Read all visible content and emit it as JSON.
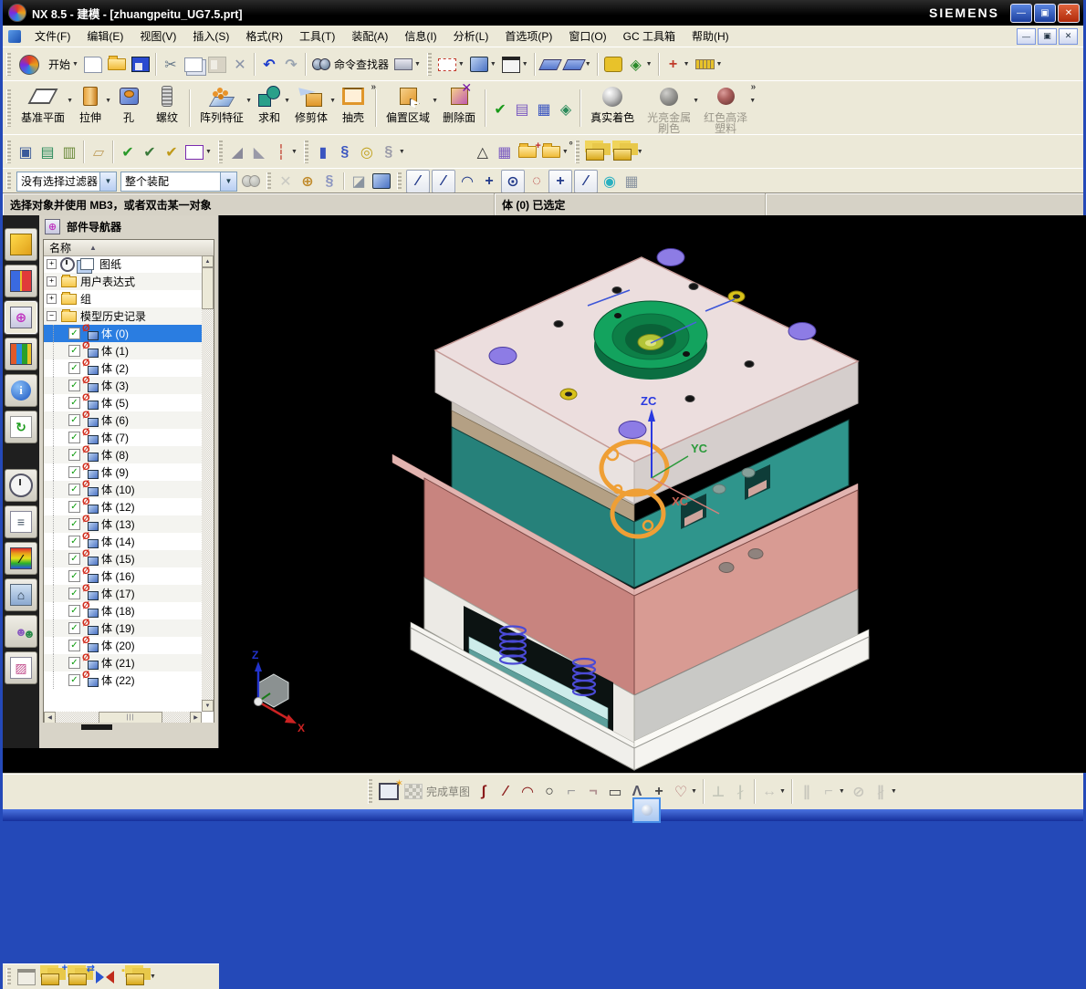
{
  "window": {
    "title": "NX 8.5 - 建模 - [zhuangpeitu_UG7.5.prt]",
    "brand": "SIEMENS"
  },
  "menubar": {
    "items": [
      "文件(F)",
      "编辑(E)",
      "视图(V)",
      "插入(S)",
      "格式(R)",
      "工具(T)",
      "装配(A)",
      "信息(I)",
      "分析(L)",
      "首选项(P)",
      "窗口(O)",
      "GC 工具箱",
      "帮助(H)"
    ]
  },
  "toolbar_standard": {
    "start_label": "开始",
    "items": [
      {
        "name": "new-document-button",
        "cls": "i-new"
      },
      {
        "name": "open-button",
        "cls": "i-openf"
      },
      {
        "name": "save-button",
        "cls": "i-save"
      },
      {
        "type": "sep"
      },
      {
        "name": "cut-button",
        "g": "✂",
        "c": "#667788"
      },
      {
        "name": "copy-button",
        "cls": "i-copy"
      },
      {
        "name": "paste-button",
        "cls": "i-paste",
        "dim": 1
      },
      {
        "name": "delete-button",
        "g": "✕",
        "c": "#8a94a8"
      },
      {
        "type": "sep"
      },
      {
        "name": "undo-button",
        "g": "↶",
        "c": "#1a3acc"
      },
      {
        "name": "redo-button",
        "g": "↷",
        "c": "#9aa4b0"
      },
      {
        "type": "sep"
      },
      {
        "name": "command-finder-button",
        "cls": "i-binoc",
        "label": "命令查找器"
      },
      {
        "name": "touch-mode-button",
        "cls": "i-laptop",
        "dd": 1
      },
      {
        "type": "grip"
      },
      {
        "name": "fit-view-button",
        "cls": "i-fit",
        "dd": 1
      },
      {
        "name": "shaded-view-button",
        "cls": "i-cube3d",
        "dd": 1
      },
      {
        "name": "view-background-button",
        "cls": "i-rect",
        "dd": 1
      },
      {
        "type": "sep"
      },
      {
        "name": "show-datum-button",
        "cls": "i-datum"
      },
      {
        "name": "show-datum-2-button",
        "cls": "i-datum",
        "dd": 1
      },
      {
        "type": "sep"
      },
      {
        "name": "snapshot-button",
        "cls": "i-key"
      },
      {
        "name": "view-orient-button",
        "g": "◈",
        "c": "#2a8a2a",
        "dd": 1
      },
      {
        "type": "sep"
      },
      {
        "name": "measure-button",
        "g": "+",
        "c": "#c03a2a",
        "dd": 1
      },
      {
        "name": "ruler-button",
        "cls": "i-ruler",
        "dd": 1
      }
    ]
  },
  "toolbar_features": {
    "buttons": [
      {
        "group": 1,
        "label": "基准平面",
        "icon": "datum-plane",
        "dd": 1
      },
      {
        "group": 1,
        "label": "拉伸",
        "icon": "extrude",
        "dd": 1
      },
      {
        "group": 1,
        "label": "孔",
        "icon": "hole"
      },
      {
        "group": 1,
        "label": "螺纹",
        "icon": "thread"
      },
      {
        "group": 2,
        "label": "阵列特征",
        "icon": "pattern",
        "dd": 1
      },
      {
        "group": 2,
        "label": "求和",
        "icon": "unite",
        "dd": 1
      },
      {
        "group": 2,
        "label": "修剪体",
        "icon": "trim-body",
        "dd": 1
      },
      {
        "group": 2,
        "label": "抽壳",
        "icon": "shell"
      },
      {
        "group": 3,
        "label": "偏置区域",
        "icon": "offset-region",
        "dd": 1
      },
      {
        "group": 3,
        "label": "删除面",
        "icon": "delete-face"
      },
      {
        "group": 5,
        "label": "真实着色",
        "icon": "true-shading"
      },
      {
        "group": 5,
        "label": "光亮金属\n刷色",
        "icon": "metal-shading",
        "dd": 1,
        "disabled": 1
      },
      {
        "group": 5,
        "label": "红色高泽\n塑料",
        "icon": "red-plastic",
        "dd": 1,
        "disabled": 1
      }
    ],
    "check_group": [
      {
        "name": "examine-geometry-check-button",
        "g": "✔",
        "c": "#1a9a1a"
      },
      {
        "name": "spreadsheet-button",
        "g": "▤",
        "c": "#7a5ac0"
      },
      {
        "name": "grid-check-button",
        "g": "▦",
        "c": "#3a55c0"
      },
      {
        "name": "sheet-metal-button",
        "g": "◈",
        "c": "#2a8a5a"
      }
    ]
  },
  "toolbar_small": {
    "items": [
      {
        "name": "fit-frame-button",
        "g": "▣",
        "c": "#3a5a9a"
      },
      {
        "name": "layer-settings-button",
        "g": "▤",
        "c": "#2a8a5a"
      },
      {
        "name": "layer-category-button",
        "g": "▥",
        "c": "#6a8a3a"
      },
      {
        "type": "sep"
      },
      {
        "name": "annotation-note-button",
        "g": "▱",
        "c": "#c0a060"
      },
      {
        "type": "sep"
      },
      {
        "name": "check-parts-button",
        "g": "✔",
        "c": "#2a9a2a"
      },
      {
        "name": "check-sketch-button",
        "g": "✔",
        "c": "#3a7a3a"
      },
      {
        "name": "check-box-button",
        "g": "✔",
        "c": "#c09a1a"
      },
      {
        "name": "abc-annotation-button",
        "cls": "i-abc",
        "dd": 1
      },
      {
        "type": "grip"
      },
      {
        "name": "draft-analysis-button",
        "g": "◢",
        "c": "#8a8a9a"
      },
      {
        "name": "section-analysis-button",
        "g": "◣",
        "c": "#9a9aa8"
      },
      {
        "name": "deviation-gauge-button",
        "g": "┆",
        "c": "#c03a2a",
        "dd": 1
      },
      {
        "type": "grip"
      },
      {
        "name": "tube-button",
        "g": "▮",
        "c": "#3a55c0"
      },
      {
        "name": "spring-tool-button",
        "g": "§",
        "c": "#3a55c0"
      },
      {
        "name": "coil-button",
        "g": "◎",
        "c": "#c0a01a"
      },
      {
        "name": "spring-disabled-button",
        "g": "§",
        "c": "#9a9aa8",
        "dd": 1
      },
      {
        "type": "gap"
      },
      {
        "name": "triangle-mesh-button",
        "g": "△",
        "c": "#333333"
      },
      {
        "name": "table-grid-button",
        "g": "▦",
        "c": "#7a5ac0"
      },
      {
        "name": "folder-new-button",
        "cls": "i-openf",
        "ov": "+",
        "ovc": "#c02a2a"
      },
      {
        "name": "folder-options-button",
        "cls": "i-openf",
        "ov": "°",
        "ovc": "#333333",
        "dd": 1
      },
      {
        "type": "grip"
      },
      {
        "name": "part-family-button",
        "cls": "i-ycubes"
      },
      {
        "name": "part-family-2-button",
        "cls": "i-ycubes",
        "dd": 1
      }
    ]
  },
  "selection_bar": {
    "filter_value": "没有选择过滤器",
    "scope_value": "整个装配",
    "items": [
      {
        "name": "selection-binoculars-button",
        "cls": "i-binoc",
        "dim": 1
      },
      {
        "type": "grip"
      },
      {
        "name": "general-selection-button",
        "g": "✕",
        "c": "#99a4b0",
        "dim": 1
      },
      {
        "name": "snap-handle-button",
        "g": "⊕",
        "c": "#c08a2a"
      },
      {
        "name": "grip-hand-button",
        "g": "§",
        "c": "#8a94c0"
      },
      {
        "type": "sep"
      },
      {
        "name": "face-rule-button",
        "g": "◪",
        "c": "#8a94a0"
      },
      {
        "name": "body-rule-button",
        "cls": "i-cube3d"
      },
      {
        "type": "grip"
      },
      {
        "name": "snap-endpoint-button",
        "g": "∕",
        "c": "#223a8a",
        "box": 1
      },
      {
        "name": "snap-midpoint-button",
        "g": "∕",
        "c": "#223a8a",
        "box": 1
      },
      {
        "name": "snap-curve-button",
        "g": "◠",
        "c": "#223a8a"
      },
      {
        "name": "snap-intersection-button",
        "g": "+",
        "c": "#223a8a"
      },
      {
        "name": "snap-center-button",
        "g": "⊙",
        "c": "#223a8a",
        "box": 1
      },
      {
        "name": "snap-quadrant-button",
        "g": "◌",
        "c": "#b02a2a"
      },
      {
        "name": "snap-point-button",
        "g": "+",
        "c": "#223a8a",
        "box": 1
      },
      {
        "name": "snap-existing-button",
        "g": "∕",
        "c": "#223a8a",
        "box": 1
      },
      {
        "name": "magnet-button",
        "g": "◉",
        "c": "#2ab0c0"
      },
      {
        "name": "grid-snap-button",
        "g": "▦",
        "c": "#8a94a0"
      }
    ]
  },
  "status_bar": {
    "prompt": "选择对象并使用 MB3，或者双击某一对象",
    "status": "体 (0) 已选定"
  },
  "resource_bar": {
    "icons": [
      {
        "name": "assembly-navigator-icon",
        "cls": "r1"
      },
      {
        "name": "constraint-navigator-icon",
        "cls": "r2"
      },
      {
        "name": "part-navigator-icon",
        "cls": "r3",
        "g": "⊕",
        "active": 1
      },
      {
        "name": "reuse-library-icon",
        "cls": "r4"
      },
      {
        "name": "web-browser-icon",
        "cls": "r5",
        "g": "i"
      },
      {
        "name": "history-icon",
        "cls": "r6",
        "g": "↻"
      },
      {
        "type": "gap"
      },
      {
        "name": "clock-icon",
        "cls": "r7"
      },
      {
        "name": "palette-list-icon",
        "cls": "r8",
        "g": "≡"
      },
      {
        "name": "visualization-icon",
        "cls": "r9",
        "g": "∕"
      },
      {
        "name": "scene-icon",
        "cls": "r10",
        "g": "⌂"
      },
      {
        "name": "roles-icon",
        "cls": "r11",
        "g": "☻"
      },
      {
        "name": "gallery-icon",
        "cls": "r12",
        "g": "▨"
      }
    ]
  },
  "navigator": {
    "title": "部件导航器",
    "column_header": "名称",
    "folders": [
      {
        "label": "图纸"
      },
      {
        "label": "用户表达式"
      },
      {
        "label": "组"
      },
      {
        "label": "模型历史记录"
      }
    ],
    "bodies": [
      "体 (0)",
      "体 (1)",
      "体 (2)",
      "体 (3)",
      "体 (5)",
      "体 (6)",
      "体 (7)",
      "体 (8)",
      "体 (9)",
      "体 (10)",
      "体 (12)",
      "体 (13)",
      "体 (14)",
      "体 (15)",
      "体 (16)",
      "体 (17)",
      "体 (18)",
      "体 (19)",
      "体 (20)",
      "体 (21)",
      "体 (22)"
    ],
    "selected": "体 (0)"
  },
  "assembly_toolbar": {
    "items": [
      {
        "name": "show-component-button",
        "cls": "i-rect",
        "dim": 1
      },
      {
        "name": "add-component-button",
        "cls": "i-ycubes",
        "ov": "+",
        "ovc": "#1a55e0"
      },
      {
        "name": "move-component-button",
        "cls": "i-ycubes",
        "ov": "⇄",
        "ovc": "#1a55e0"
      },
      {
        "name": "assembly-constraints-button",
        "cls": "i-bowtie",
        "ov": "▪",
        "ovc": "#e8c22a"
      },
      {
        "name": "pattern-component-button",
        "cls": "i-ycubes",
        "dd": 1
      }
    ]
  },
  "sketch_toolbar": {
    "items": [
      {
        "name": "sketch-profile-button",
        "cls": "i-profile",
        "ov": "✶",
        "ovc": "#e8a01a"
      },
      {
        "name": "finish-sketch-button",
        "cls": "i-checker",
        "label": "完成草图",
        "dim": 1
      },
      {
        "name": "studio-spline-button",
        "g": "∫",
        "c": "#8a1a1a"
      },
      {
        "name": "line-button",
        "g": "∕",
        "c": "#8a1a1a"
      },
      {
        "name": "arc-button",
        "g": "◠",
        "c": "#8a1a1a"
      },
      {
        "name": "circle-button",
        "g": "○",
        "c": "#333333"
      },
      {
        "name": "fillet-button",
        "g": "⌐",
        "c": "#9a9a9a"
      },
      {
        "name": "chamfer-button",
        "g": "¬",
        "c": "#b09090"
      },
      {
        "name": "rectangle-button",
        "g": "▭",
        "c": "#444444"
      },
      {
        "name": "polygon-button",
        "g": "Λ",
        "c": "#555566"
      },
      {
        "name": "point-button",
        "g": "+",
        "c": "#444444"
      },
      {
        "name": "offset-curve-button",
        "g": "♡",
        "c": "#b07070",
        "dd": 1
      },
      {
        "type": "sep"
      },
      {
        "name": "constraint-button",
        "g": "⊥",
        "c": "#88a088",
        "dim": 1
      },
      {
        "name": "auto-constrain-button",
        "g": "∤",
        "c": "#88a088",
        "dim": 1
      },
      {
        "type": "sep"
      },
      {
        "name": "dimension-button",
        "g": "↔",
        "c": "#9a9a9a",
        "dd": 1,
        "dim": 1
      },
      {
        "type": "sep"
      },
      {
        "name": "parallel-button",
        "g": "∥",
        "c": "#9a9a9a",
        "dim": 1
      },
      {
        "name": "perpendicular-button",
        "g": "⌐",
        "c": "#9a9a9a",
        "dd": 1,
        "dim": 1
      },
      {
        "name": "tangent-button",
        "g": "⊘",
        "c": "#9a9a9a",
        "dim": 1
      },
      {
        "name": "equal-button",
        "g": "∦",
        "c": "#9a9a9a",
        "dd": 1,
        "dim": 1
      }
    ]
  },
  "viewport": {
    "wcs": {
      "z": "ZC",
      "y": "YC",
      "x": "XC"
    },
    "triad": {
      "z": "Z",
      "x": "X"
    },
    "colors": {
      "viewport_bg": "#000000",
      "top_plate": "#ecdede",
      "a_plate_teal": "#26817a",
      "a_plate_teal_right": "#2f958c",
      "b_plate_salmon": "#c8847f",
      "b_plate_salmon_right": "#d89b93",
      "base_gray": "#f0efeb",
      "support_gray": "#c9c9c6",
      "locating_ring_green": "#13a35e",
      "hole_purple": "#8d7ce5",
      "spring_blue": "#4a4ad6",
      "sketch_orange": "#ef9f35",
      "selection_blue": "#2a7de1"
    }
  }
}
